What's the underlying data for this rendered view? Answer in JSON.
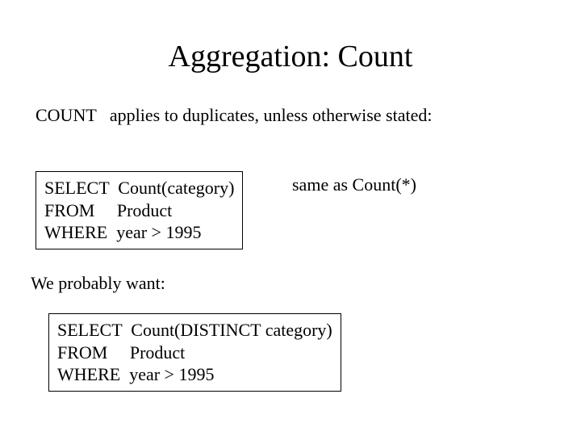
{
  "title": "Aggregation: Count",
  "intro": "COUNT   applies to duplicates, unless otherwise stated:",
  "query1": {
    "line1": "SELECT  Count(category)",
    "line2": "FROM     Product",
    "line3": "WHERE  year > 1995"
  },
  "annotation": "same as Count(*)",
  "subtext": "We probably want:",
  "query2": {
    "line1": "SELECT  Count(DISTINCT category)",
    "line2": "FROM     Product",
    "line3": "WHERE  year > 1995"
  }
}
